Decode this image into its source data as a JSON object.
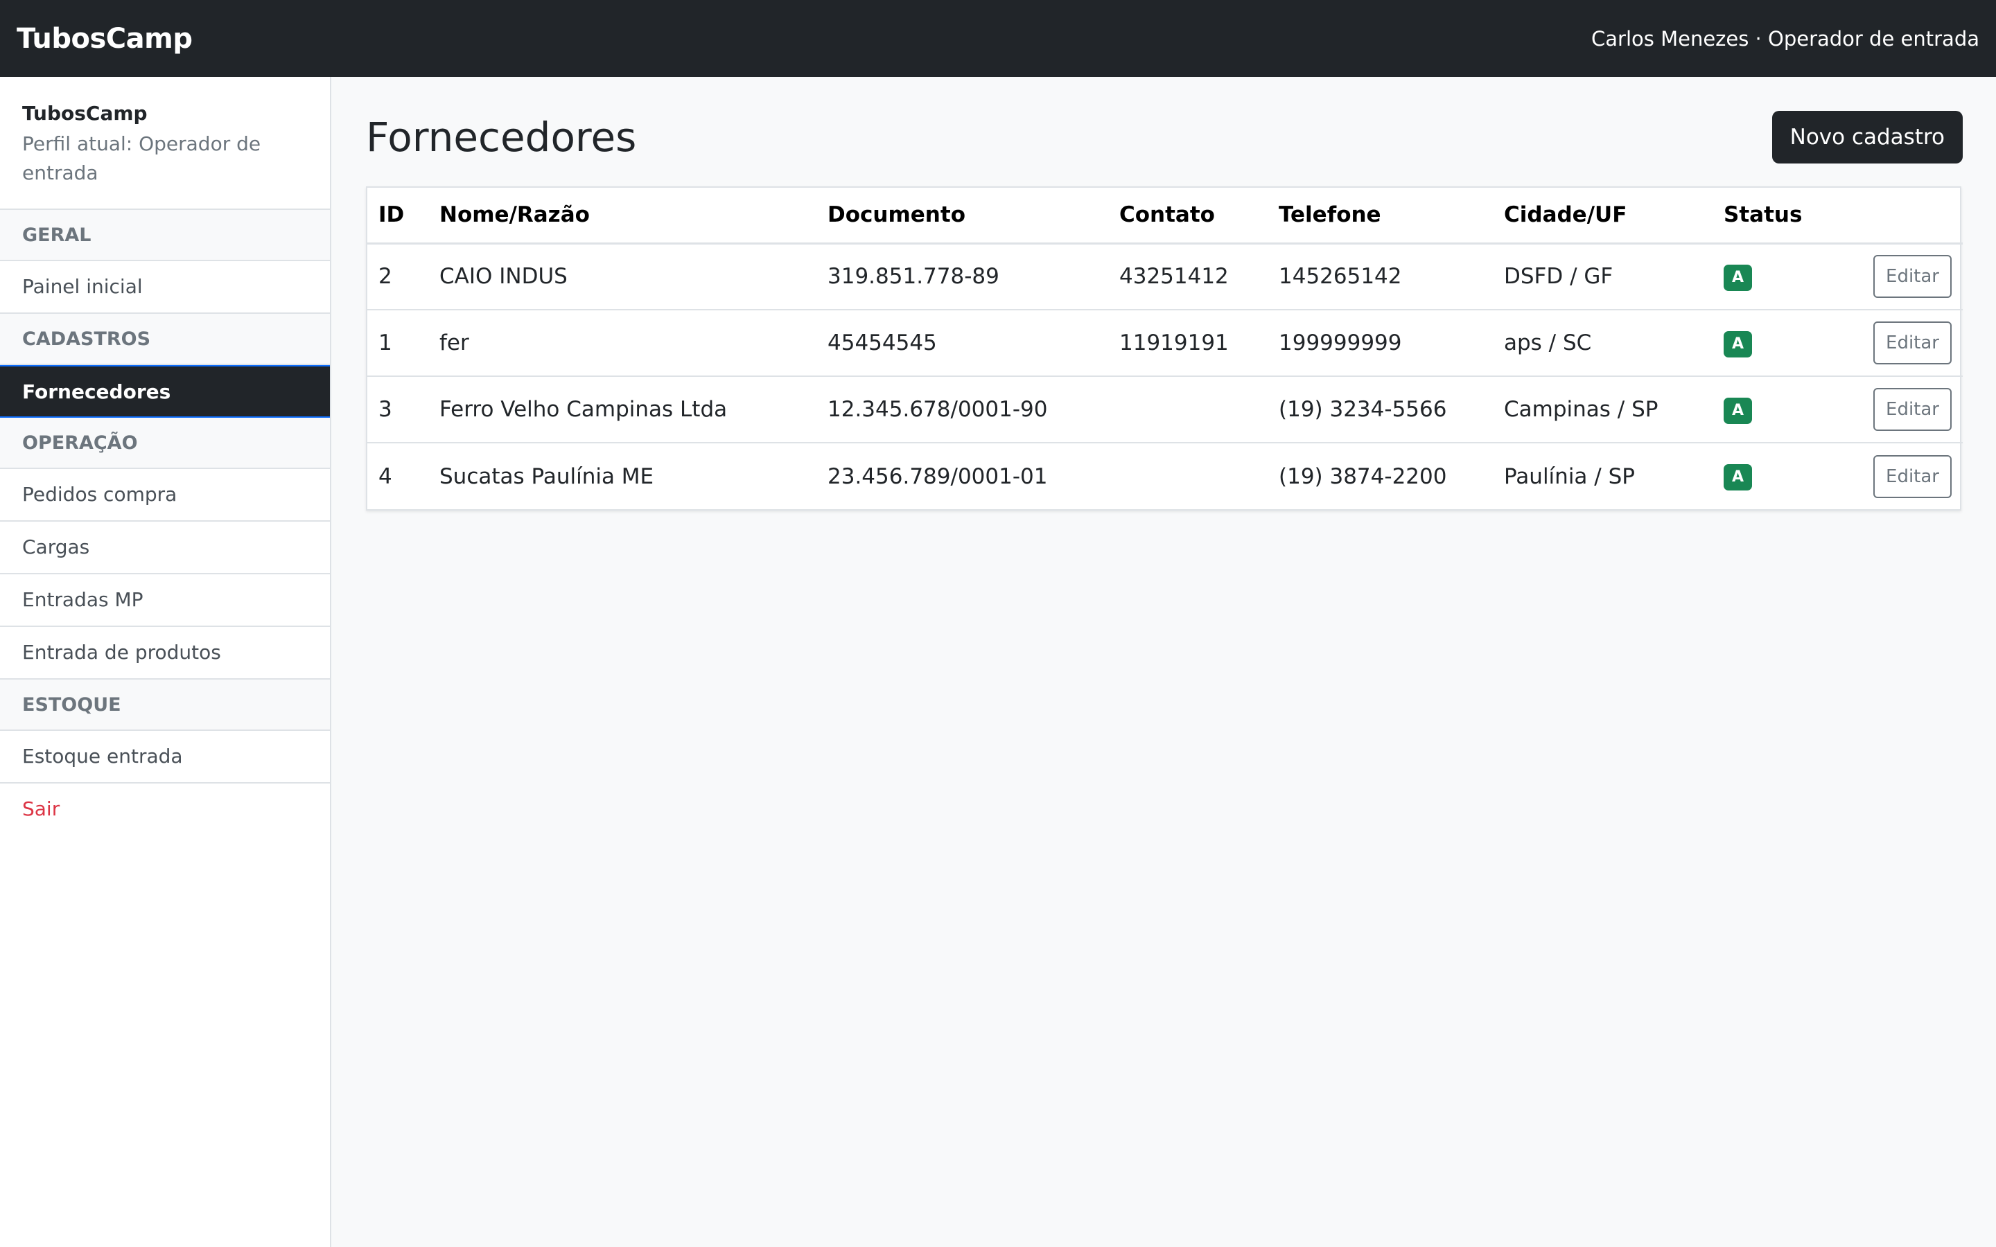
{
  "topbar": {
    "brand": "TubosCamp",
    "user": "Carlos Menezes · Operador de entrada"
  },
  "sidebar": {
    "title": "TubosCamp",
    "profile": "Perfil atual: Operador de entrada",
    "sections": {
      "geral": "GERAL",
      "cadastros": "CADASTROS",
      "operacao": "OPERAÇÃO",
      "estoque": "ESTOQUE"
    },
    "items": {
      "painel": "Painel inicial",
      "fornecedores": "Fornecedores",
      "pedidos": "Pedidos compra",
      "cargas": "Cargas",
      "entradas_mp": "Entradas MP",
      "entrada_produtos": "Entrada de produtos",
      "estoque_entrada": "Estoque entrada",
      "sair": "Sair"
    }
  },
  "main": {
    "title": "Fornecedores",
    "new_button": "Novo cadastro"
  },
  "table": {
    "headers": [
      "ID",
      "Nome/Razão",
      "Documento",
      "Contato",
      "Telefone",
      "Cidade/UF",
      "Status",
      ""
    ],
    "rows": [
      {
        "id": "2",
        "nome": "CAIO INDUS",
        "documento": "319.851.778-89",
        "contato": "43251412",
        "telefone": "145265142",
        "cidade": "DSFD / GF",
        "status": "A",
        "action": "Editar"
      },
      {
        "id": "1",
        "nome": "fer",
        "documento": "45454545",
        "contato": "11919191",
        "telefone": "199999999",
        "cidade": "aps / SC",
        "status": "A",
        "action": "Editar"
      },
      {
        "id": "3",
        "nome": "Ferro Velho Campinas Ltda",
        "documento": "12.345.678/0001-90",
        "contato": "",
        "telefone": "(19) 3234-5566",
        "cidade": "Campinas / SP",
        "status": "A",
        "action": "Editar"
      },
      {
        "id": "4",
        "nome": "Sucatas Paulínia ME",
        "documento": "23.456.789/0001-01",
        "contato": "",
        "telefone": "(19) 3874-2200",
        "cidade": "Paulínia / SP",
        "status": "A",
        "action": "Editar"
      }
    ]
  },
  "colors": {
    "topbar_bg": "#212529",
    "active_bg": "#212529",
    "badge_success": "#198754",
    "logout_red": "#dc3545"
  }
}
